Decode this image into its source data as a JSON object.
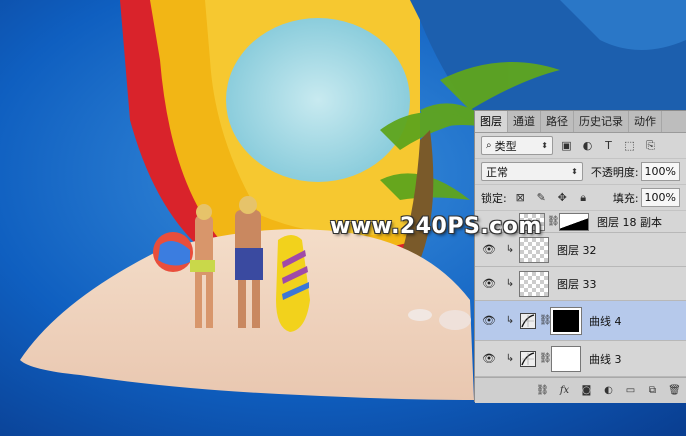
{
  "watermark": "www.240PS.com",
  "panel": {
    "tabs": [
      "图层",
      "通道",
      "路径",
      "历史记录",
      "动作"
    ],
    "filter": {
      "label": "类型"
    },
    "blend_mode": "正常",
    "opacity_label": "不透明度:",
    "opacity_value": "100%",
    "lock_label": "锁定:",
    "fill_label": "填充:",
    "fill_value": "100%",
    "layers": [
      {
        "name": "图层 18 副本"
      },
      {
        "name": "图层 32"
      },
      {
        "name": "图层 33"
      },
      {
        "name": "曲线 4"
      },
      {
        "name": "曲线 3"
      }
    ]
  },
  "colors": {
    "background": "#0a57b8",
    "panel": "#d6d6d6",
    "selected_row": "#b6c9eb"
  }
}
